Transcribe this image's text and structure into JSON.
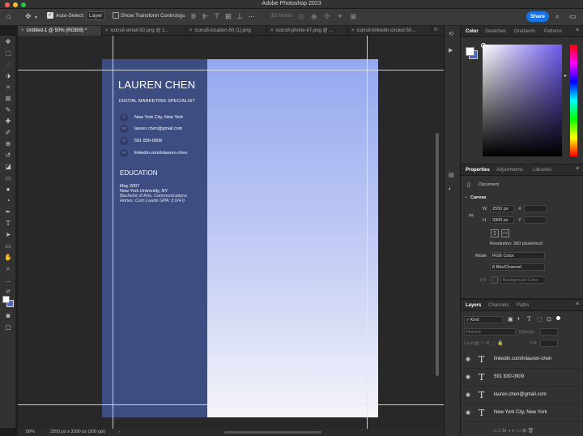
{
  "window": {
    "title": "Adobe Photoshop 2023"
  },
  "options_bar": {
    "auto_select_label": "Auto-Select:",
    "layer_select": "Layer",
    "show_transform_label": "Show Transform Controls",
    "mode_3d": "3D Mode:",
    "share_label": "Share"
  },
  "tabs": [
    {
      "label": "Untitled-1 @ 50% (RGB/8) *"
    },
    {
      "label": "icons8-email-50.png @ 1..."
    },
    {
      "label": "icons8-location-50 (1).png"
    },
    {
      "label": "icons8-phone-67.png @ ..."
    },
    {
      "label": "icons8-linkedin-circled-50..."
    }
  ],
  "resume": {
    "name": "LAUREN CHEN",
    "subtitle": "DIGITAL MARKETING SPECIALIST",
    "contacts": [
      {
        "text": "New York City, New York",
        "icon": "location-icon"
      },
      {
        "text": "lauren.chen@gmail.com",
        "icon": "email-icon"
      },
      {
        "text": "591 830-0909",
        "icon": "phone-icon"
      },
      {
        "text": "linkedin.com/inlauren-chen",
        "icon": "linkedin-icon"
      }
    ],
    "education_heading": "EDUCATION",
    "education_lines": [
      "May 2007",
      "New York University, NY",
      "Bachelor of Arts, Communications",
      "Hones: Cum Laude GPA: 3.6/4.0"
    ]
  },
  "status": {
    "zoom": "50%",
    "doc_size": "2550 px x 3300 px (300 ppi)"
  },
  "color_panel": {
    "tabs": [
      "Color",
      "Swatches",
      "Gradients",
      "Patterns"
    ]
  },
  "properties_panel": {
    "tabs": [
      "Properties",
      "Adjustments",
      "Libraries"
    ],
    "document_label": "Document",
    "canvas_label": "Canvas",
    "w_label": "W",
    "w_value": "2550 px",
    "h_label": "H",
    "h_value": "3300 px",
    "x_label": "X",
    "y_label": "Y",
    "resolution": "Resolution: 300 pixels/inch",
    "mode_label": "Mode",
    "mode_value": "RGB Color",
    "bits_value": "8 Bits/Channel",
    "fill_label": "Fill",
    "fill_value": "Background Color"
  },
  "layers_panel": {
    "tabs": [
      "Layers",
      "Channels",
      "Paths"
    ],
    "filter_kind": "Kind",
    "blend_mode": "Normal",
    "opacity_label": "Opacity:",
    "lock_label": "Lock:",
    "fill_label": "Fill:",
    "layers": [
      {
        "name": "linkedin.com/inlauren-chen"
      },
      {
        "name": "591 830-0909"
      },
      {
        "name": "lauren.chen@gmail.com"
      },
      {
        "name": "New York City, New York"
      }
    ]
  },
  "colors": {
    "resume_sidebar": "#3e4d81",
    "accent": "#1473e6",
    "foreground_swatch": "#ffffff",
    "background_swatch": "#4a64c8"
  }
}
